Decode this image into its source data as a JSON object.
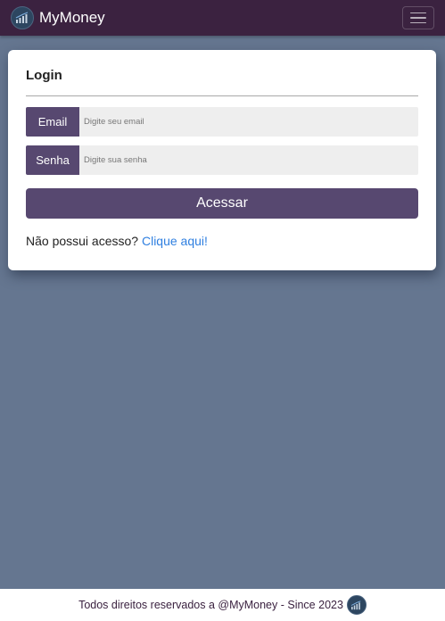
{
  "navbar": {
    "brand_name": "MyMoney",
    "brand_logo_icon": "money-chart-icon",
    "menu_icon": "hamburger-menu-icon",
    "background_color": "#3b2240"
  },
  "login": {
    "title": "Login",
    "email": {
      "label": "Email",
      "placeholder": "Digite seu email",
      "value": ""
    },
    "password": {
      "label": "Senha",
      "placeholder": "Digite sua senha",
      "value": ""
    },
    "submit_label": "Acessar",
    "signup_prompt": "Não possui acesso?",
    "signup_link": "Clique aqui!",
    "accent_color": "#574870",
    "link_color": "#2f7fe0"
  },
  "footer": {
    "text": "Todos direitos reservados a @MyMoney - Since 2023",
    "logo_icon": "money-chart-icon"
  },
  "page": {
    "background_color": "#657690"
  }
}
